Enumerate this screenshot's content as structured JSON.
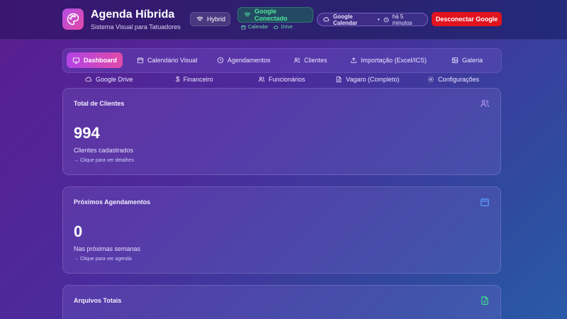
{
  "header": {
    "title": "Agenda Híbrida",
    "subtitle": "Sistema Visual para Tatuadores",
    "mode_label": "Hybrid",
    "google_status": "Google Conectado",
    "google_links": [
      "Calendar",
      "Drive"
    ],
    "calendar_sync": {
      "label": "Google Calendar",
      "separator": "•",
      "time": "há 5 minutos"
    },
    "disconnect_label": "Desconectar Google"
  },
  "nav": {
    "row1": [
      {
        "label": "Dashboard",
        "icon": "monitor-icon",
        "active": true
      },
      {
        "label": "Calendário Visual",
        "icon": "calendar-icon"
      },
      {
        "label": "Agendamentos",
        "icon": "clock-icon"
      },
      {
        "label": "Clientes",
        "icon": "users-icon"
      },
      {
        "label": "Importação (Excel/ICS)",
        "icon": "upload-icon"
      },
      {
        "label": "Galeria",
        "icon": "image-icon"
      }
    ],
    "row2": [
      {
        "label": "Google Drive",
        "icon": "cloud-icon"
      },
      {
        "label": "Financeiro",
        "icon": "dollar-icon"
      },
      {
        "label": "Funcionários",
        "icon": "users-icon"
      },
      {
        "label": "Vagaro (Completo)",
        "icon": "file-icon"
      },
      {
        "label": "Configurações",
        "icon": "gear-icon"
      }
    ]
  },
  "cards": [
    {
      "title": "Total de Clientes",
      "value": "994",
      "description": "Clientes cadastrados",
      "link": "→ Clique para ver detalhes",
      "icon": "users-icon",
      "icon_color": "#b99cf5"
    },
    {
      "title": "Próximos Agendamentos",
      "value": "0",
      "description": "Nas próximas semanas",
      "link": "→ Clique para ver agenda",
      "icon": "calendar-icon",
      "icon_color": "#5aa0ff"
    },
    {
      "title": "Arquivos Totais",
      "value": "",
      "description": "",
      "link": "",
      "icon": "file-check-icon",
      "icon_color": "#3ee38a"
    }
  ],
  "colors": {
    "accent_active": "#c247d8",
    "danger": "#e0131f",
    "success": "#4ee49a"
  }
}
